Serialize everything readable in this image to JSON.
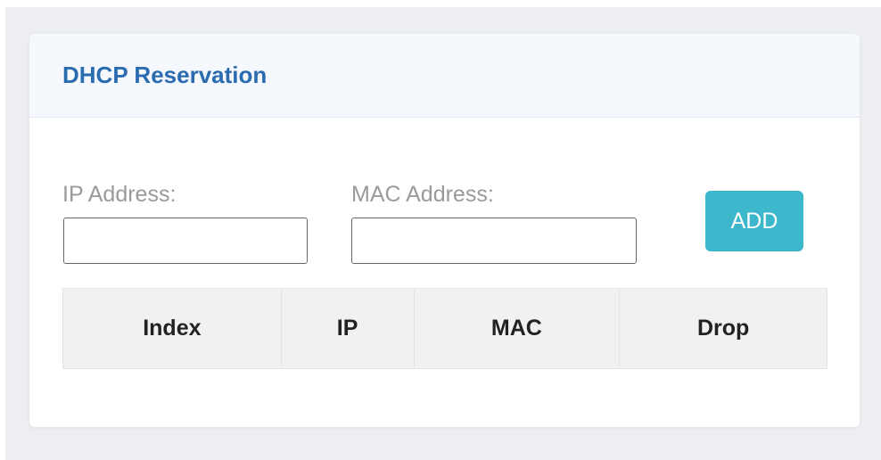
{
  "card": {
    "title": "DHCP Reservation"
  },
  "form": {
    "ip_label": "IP Address:",
    "ip_value": "",
    "mac_label": "MAC Address:",
    "mac_value": "",
    "add_label": "ADD"
  },
  "table": {
    "columns": [
      "Index",
      "IP",
      "MAC",
      "Drop"
    ],
    "rows": []
  },
  "colors": {
    "title": "#2b6cb0",
    "add_button": "#3db7cb",
    "header_bg": "#f5f8fc",
    "table_header_bg": "#f1f1f1"
  }
}
